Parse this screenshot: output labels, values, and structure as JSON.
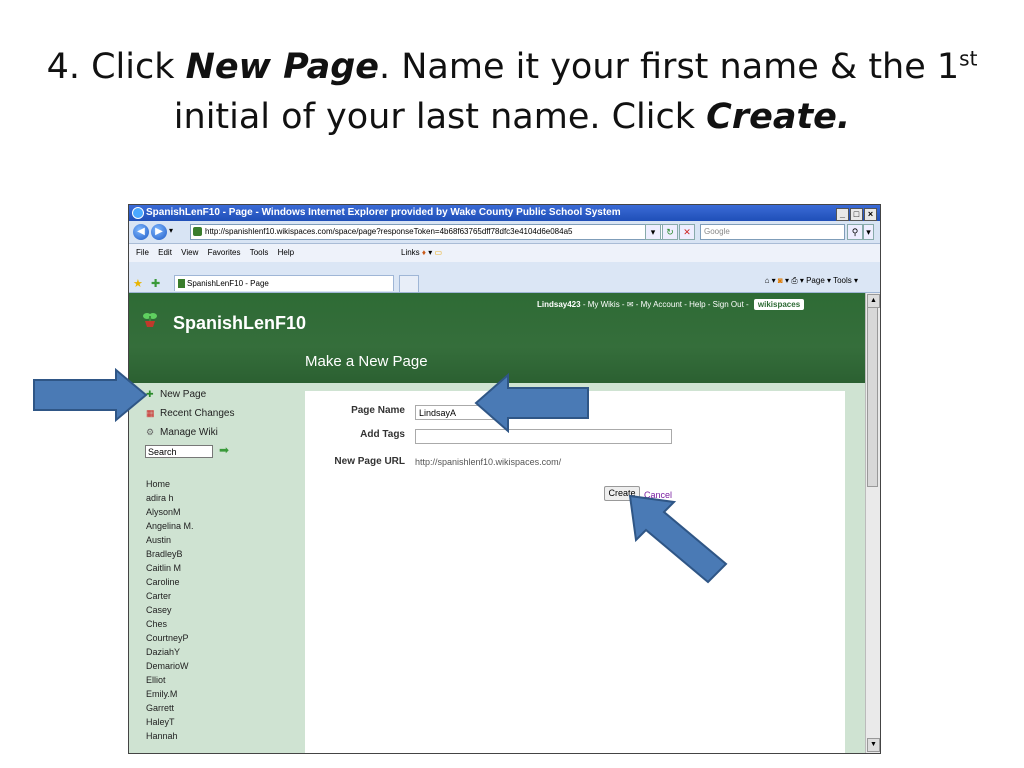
{
  "slide": {
    "title_prefix": "4. Click ",
    "title_bold1": "New Page",
    "title_mid": ". Name it your first name & the 1",
    "title_sup": "st",
    "title_after": " initial of your last name. Click ",
    "title_bold2": "Create."
  },
  "browser": {
    "window_title": "SpanishLenF10 - Page - Windows Internet Explorer provided by Wake County Public School System",
    "window_buttons": [
      "_",
      "□",
      "×"
    ],
    "address_url": "http://spanishlenf10.wikispaces.com/space/page?responseToken=4b68f63765dff78dfc3e4104d6e084a5",
    "search_placeholder": "Google",
    "menu": [
      "File",
      "Edit",
      "View",
      "Favorites",
      "Tools",
      "Help"
    ],
    "links_label": "Links",
    "tab_title": "SpanishLenF10 - Page",
    "cmdbar": [
      "Page ▾",
      "Tools ▾"
    ]
  },
  "site": {
    "title": "SpanishLenF10",
    "page_heading": "Make a New Page",
    "user": "Lindsay423",
    "user_links": [
      " - My Wikis - ",
      " - My Account - Help - Sign Out - "
    ],
    "badge": "wikispaces"
  },
  "sidebar": {
    "actions": [
      "New Page",
      "Recent Changes",
      "Manage Wiki"
    ],
    "search_value": "Search",
    "pages": [
      "Home",
      "adira h",
      "AlysonM",
      "Angelina M.",
      "Austin",
      "BradleyB",
      "Caitlin M",
      "Caroline",
      "Carter",
      "Casey",
      "Ches",
      "CourtneyP",
      "DaziahY",
      "DemarioW",
      "Elliot",
      "Emily.M",
      "Garrett",
      "HaleyT",
      "Hannah"
    ]
  },
  "form": {
    "page_name_label": "Page Name",
    "page_name_value": "LindsayA",
    "tags_label": "Add Tags",
    "tags_value": "",
    "url_label": "New Page URL",
    "url_value": "http://spanishlenf10.wikispaces.com/",
    "create_label": "Create",
    "cancel_label": "Cancel"
  },
  "colors": {
    "header_green": "#2e6b35",
    "sidebar_green": "#cfe3d2",
    "arrow_blue": "#4a7ab5"
  }
}
